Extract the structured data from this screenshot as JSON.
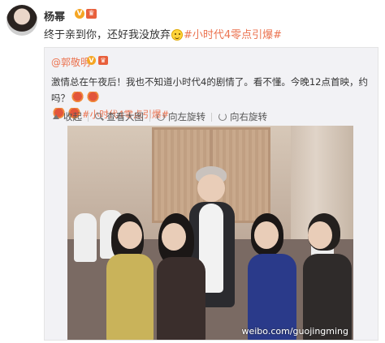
{
  "post": {
    "author": "杨幂",
    "text": "终于亲到你，还好我没放弃",
    "hashtag": "#小时代4零点引爆#"
  },
  "repost": {
    "author": "@郭敬明",
    "text": "激情总在午夜后！我也不知道小时代4的剧情了。看不懂。今晚12点首映，约吗？",
    "hashtag": "#小时代4零点引爆#"
  },
  "toolbar": {
    "collapse_label": "收起",
    "zoom_label": "查看大图",
    "rotate_left_label": "向左旋转",
    "rotate_right_label": "向右旋转"
  },
  "photo": {
    "watermark": "weibo.com/guojingming"
  },
  "icons": {
    "verified": "v-badge-icon",
    "membership": "crown-icon",
    "smile_emoji": "smile-emoji-icon",
    "mascot_emoji": "mascot-emoji-icon"
  },
  "colors": {
    "link": "#eb7350",
    "verified": "#f5a623",
    "repost_bg": "#f2f2f5"
  }
}
